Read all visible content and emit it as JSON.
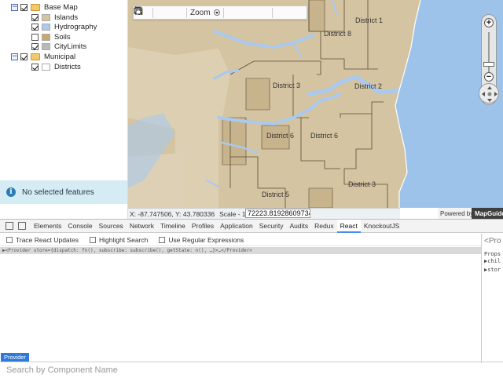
{
  "legend": {
    "groups": [
      {
        "label": "Base Map",
        "expanded": true,
        "checked": true,
        "layers": [
          {
            "label": "Islands",
            "checked": true,
            "color": "#d5c4a1"
          },
          {
            "label": "Hydrography",
            "checked": true,
            "color": "#a9c9ef"
          },
          {
            "label": "Soils",
            "checked": false,
            "color": "#c8a96a"
          },
          {
            "label": "CityLimits",
            "checked": true,
            "color": "#b9b9b9"
          }
        ]
      },
      {
        "label": "Municipal",
        "expanded": true,
        "checked": true,
        "layers": [
          {
            "label": "Districts",
            "checked": true,
            "color": "#ffffff"
          }
        ]
      }
    ],
    "toggle_symbol": "−"
  },
  "selection": {
    "text": "No selected features",
    "icon": "info-icon"
  },
  "map": {
    "toolbar": {
      "zoom_label": "Zoom"
    },
    "districts": [
      "District 1",
      "District 8",
      "District 3",
      "District 2",
      "District 6",
      "District 6",
      "District 5",
      "District 3"
    ],
    "colors": {
      "land": "#d5c4a1",
      "water": "#a9c9ef",
      "lake": "#9dc3eb",
      "boundary": "#5b4a34"
    },
    "coordinates": "X: -87.747506, Y: 43.780336",
    "scale_label": "Scale - 1:",
    "scale_value": "72223.81928609734",
    "powered_by": "Powered by",
    "logo_text": "MapGuide",
    "zoom_in": "+",
    "zoom_out": "−",
    "collapse_symbol": "«"
  },
  "devtools": {
    "tabs": [
      "Elements",
      "Console",
      "Sources",
      "Network",
      "Timeline",
      "Profiles",
      "Application",
      "Security",
      "Audits",
      "Redux",
      "React",
      "KnockoutJS"
    ],
    "active_tab": "React",
    "options": [
      "Trace React Updates",
      "Highlight Search",
      "Use Regular Expressions"
    ],
    "provider_line": "▶<Provider store={dispatch: fn(), subscribe: subscribe(), getState: n(), …}>…</Provider>",
    "side": {
      "title": "<Pro",
      "props": "Props",
      "items": [
        "▶chil",
        "▶stor"
      ]
    },
    "breadcrumb": "Provider",
    "search_placeholder": "Search by Component Name"
  }
}
